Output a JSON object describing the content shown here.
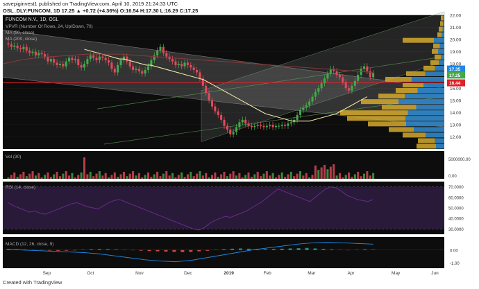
{
  "header": {
    "publisher_line": "savepiginvest1 published on TradingView.com, April 10, 2019 21:24:33 UTC",
    "symbol_line": "OSL_DLY:FUNCOM, 1D  17.25  ▲ +0.72 (+4.36%)  O:16.54  H:17.30  L:16.29  C:17.25"
  },
  "footer": {
    "brand": "Created with  TradingView"
  },
  "overlay": {
    "title": "FUNCOM N.V., 1D, OSL",
    "indicators": [
      "VPVR (Number Of Rows, 24, Up/Down, 70)",
      "MA (50, close)",
      "MA (200, close)"
    ]
  },
  "colors": {
    "background": "#0d0d0d",
    "up": "#45a84a",
    "down": "#e04a5a",
    "ma50": "#f0e6a0",
    "ma200": "#8b3a3a",
    "level_line": "#e0202a",
    "rsi_band": "#2a1a3a",
    "rsi_line": "#6a2a8a",
    "vpvr_up": "#2f86c9",
    "vpvr_down": "#d4a92e"
  },
  "chart_data": [
    {
      "type": "candlestick",
      "title": "FUNCOM N.V., 1D, OSL",
      "ylim": [
        11.0,
        22.0
      ],
      "y_ticks": [
        "12.00",
        "13.00",
        "14.00",
        "15.00",
        "16.00",
        "17.00",
        "18.00",
        "19.00",
        "20.00",
        "21.00",
        "22.00"
      ],
      "x_ticks": [
        "Sep",
        "Oct",
        "Nov",
        "Dec",
        "2019",
        "Feb",
        "Mar",
        "Apr",
        "May",
        "Jun"
      ],
      "price_labels": [
        {
          "value": "17.35",
          "color": "#1e88e5"
        },
        {
          "value": "17.25",
          "color": "#45a84a"
        },
        {
          "value": "16.44",
          "color": "#e0202a"
        }
      ],
      "horizontal_level": 16.44,
      "closes": [
        19.6,
        19.4,
        19.5,
        19.3,
        19.2,
        19.4,
        19.1,
        18.9,
        19.0,
        18.7,
        18.9,
        18.8,
        18.6,
        18.2,
        18.4,
        18.1,
        17.9,
        18.0,
        17.8,
        18.2,
        18.5,
        18.3,
        18.4,
        17.9,
        17.7,
        18.0,
        18.4,
        18.7,
        18.5,
        18.3,
        18.6,
        18.5,
        18.3,
        18.1,
        17.6,
        17.3,
        17.9,
        18.3,
        18.6,
        18.2,
        17.8,
        17.5,
        17.6,
        17.4,
        17.2,
        17.5,
        17.8,
        18.3,
        18.7,
        19.1,
        19.4,
        18.9,
        18.6,
        18.4,
        18.2,
        17.9,
        18.0,
        17.8,
        18.1,
        17.9,
        17.7,
        17.5,
        17.3,
        16.8,
        16.2,
        15.6,
        15.0,
        14.5,
        14.1,
        13.8,
        13.4,
        12.9,
        12.6,
        12.2,
        12.4,
        12.8,
        13.2,
        13.4,
        13.1,
        12.9,
        12.8,
        12.9,
        13.0,
        12.9,
        12.8,
        12.9,
        13.0,
        12.8,
        12.9,
        12.9,
        13.0,
        12.9,
        13.1,
        13.2,
        13.4,
        13.8,
        14.2,
        14.4,
        14.6,
        14.9,
        15.3,
        15.7,
        16.0,
        16.4,
        16.8,
        17.2,
        17.6,
        17.4,
        17.1,
        16.9,
        16.5,
        16.0,
        15.8,
        16.2,
        16.6,
        17.1,
        17.6,
        17.8,
        17.4,
        16.9,
        17.25
      ],
      "ma50": [
        19.2,
        19.1,
        19.0,
        18.9,
        18.8,
        18.7,
        18.6,
        18.5,
        18.4,
        18.4,
        18.3,
        18.2,
        18.1,
        18.0,
        17.9,
        17.9,
        17.8,
        17.7,
        17.6,
        17.5,
        17.4,
        17.3,
        17.2,
        17.1,
        17.0,
        16.9,
        16.8,
        16.7,
        16.5,
        16.3,
        16.1,
        15.9,
        15.7,
        15.5,
        15.3,
        15.1,
        14.9,
        14.7,
        14.5,
        14.3,
        14.1,
        13.9,
        13.8,
        13.7,
        13.6,
        13.5,
        13.4,
        13.3,
        13.3,
        13.3,
        13.3,
        13.3,
        13.4,
        13.5,
        13.6,
        13.7,
        13.8,
        13.9,
        14.1,
        14.3,
        14.5,
        14.7,
        14.9,
        15.1,
        15.3
      ],
      "ma200": [
        18.0,
        18.3,
        18.5,
        18.6,
        18.7,
        18.8,
        18.8,
        18.8,
        18.7,
        18.6,
        18.5,
        18.4,
        18.3,
        18.2,
        18.1,
        18.0,
        17.9,
        17.8,
        17.7,
        17.6,
        17.5,
        17.4,
        17.3
      ]
    },
    {
      "type": "bar",
      "title": "Vol (30)",
      "y_ticks": [
        "5000000.00",
        "0.00"
      ]
    },
    {
      "type": "line",
      "title": "RSI (14, close)",
      "ylim": [
        25,
        75
      ],
      "y_ticks": [
        "70.0000",
        "60.0000",
        "50.0000",
        "40.0000",
        "30.0000"
      ],
      "values": [
        55,
        52,
        50,
        48,
        46,
        47,
        45,
        44,
        46,
        48,
        50,
        52,
        54,
        55,
        53,
        51,
        50,
        49,
        52,
        55,
        57,
        58,
        56,
        54,
        52,
        50,
        48,
        46,
        44,
        42,
        40,
        38,
        36,
        34,
        32,
        30,
        29,
        31,
        35,
        38,
        40,
        42,
        41,
        43,
        45,
        47,
        50,
        53,
        56,
        60,
        64,
        68,
        66,
        64,
        62,
        60,
        58,
        56,
        60,
        64,
        68,
        70,
        69,
        66,
        62,
        60,
        58,
        57,
        56,
        58
      ]
    },
    {
      "type": "bar",
      "title": "MACD (12, 26, close, 9)",
      "ylim": [
        -1.4,
        1.0
      ],
      "y_ticks": [
        "0.00",
        "-1.00"
      ],
      "histogram": [
        0.08,
        0.06,
        0.04,
        0.02,
        -0.02,
        -0.04,
        -0.06,
        -0.05,
        -0.03,
        0.02,
        0.05,
        0.07,
        0.06,
        0.04,
        0.02,
        -0.02,
        -0.05,
        -0.08,
        -0.1,
        -0.12,
        -0.14,
        -0.16,
        -0.14,
        -0.1,
        -0.06,
        0.02,
        0.06,
        0.1,
        0.12,
        0.1,
        0.08,
        0.06,
        0.08,
        0.1,
        0.12,
        0.14,
        0.16,
        0.12,
        0.08,
        0.05,
        0.02,
        -0.02,
        0.02,
        0.05,
        0.03
      ],
      "macd_line": [
        0.05,
        0.0,
        -0.05,
        -0.1,
        -0.15,
        -0.2,
        -0.3,
        -0.45,
        -0.6,
        -0.75,
        -0.85,
        -0.9,
        -0.8,
        -0.6,
        -0.4,
        -0.2,
        0.0,
        0.15,
        0.3,
        0.45,
        0.55,
        0.6,
        0.55,
        0.5,
        0.45
      ]
    }
  ]
}
